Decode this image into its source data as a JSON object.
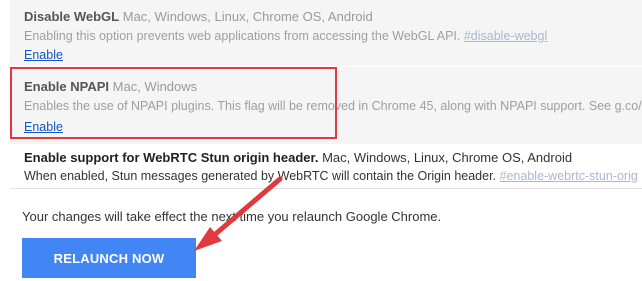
{
  "flags": [
    {
      "name": "Disable WebGL",
      "platforms": "Mac, Windows, Linux, Chrome OS, Android",
      "description": "Enabling this option prevents web applications from accessing the WebGL API.",
      "anchor": "#disable-webgl",
      "action": "Enable"
    },
    {
      "name": "Enable NPAPI",
      "platforms": "Mac, Windows",
      "description": "Enables the use of NPAPI plugins. This flag will be removed in Chrome 45, along with NPAPI support. See g.co/n",
      "action": "Enable"
    },
    {
      "name": "Enable support for WebRTC Stun origin header.",
      "platforms": "Mac, Windows, Linux, Chrome OS, Android",
      "description": "When enabled, Stun messages generated by WebRTC will contain the Origin header.",
      "anchor": "#enable-webrtc-stun-orig"
    }
  ],
  "relaunch": {
    "message": "Your changes will take effect the next time you relaunch Google Chrome.",
    "button_label": "RELAUNCH NOW"
  },
  "colors": {
    "annotation_red": "#e0393e",
    "button_blue": "#4285f4",
    "link_blue": "#1155cc"
  },
  "icons": {
    "annotation": "red-arrow-icon"
  }
}
